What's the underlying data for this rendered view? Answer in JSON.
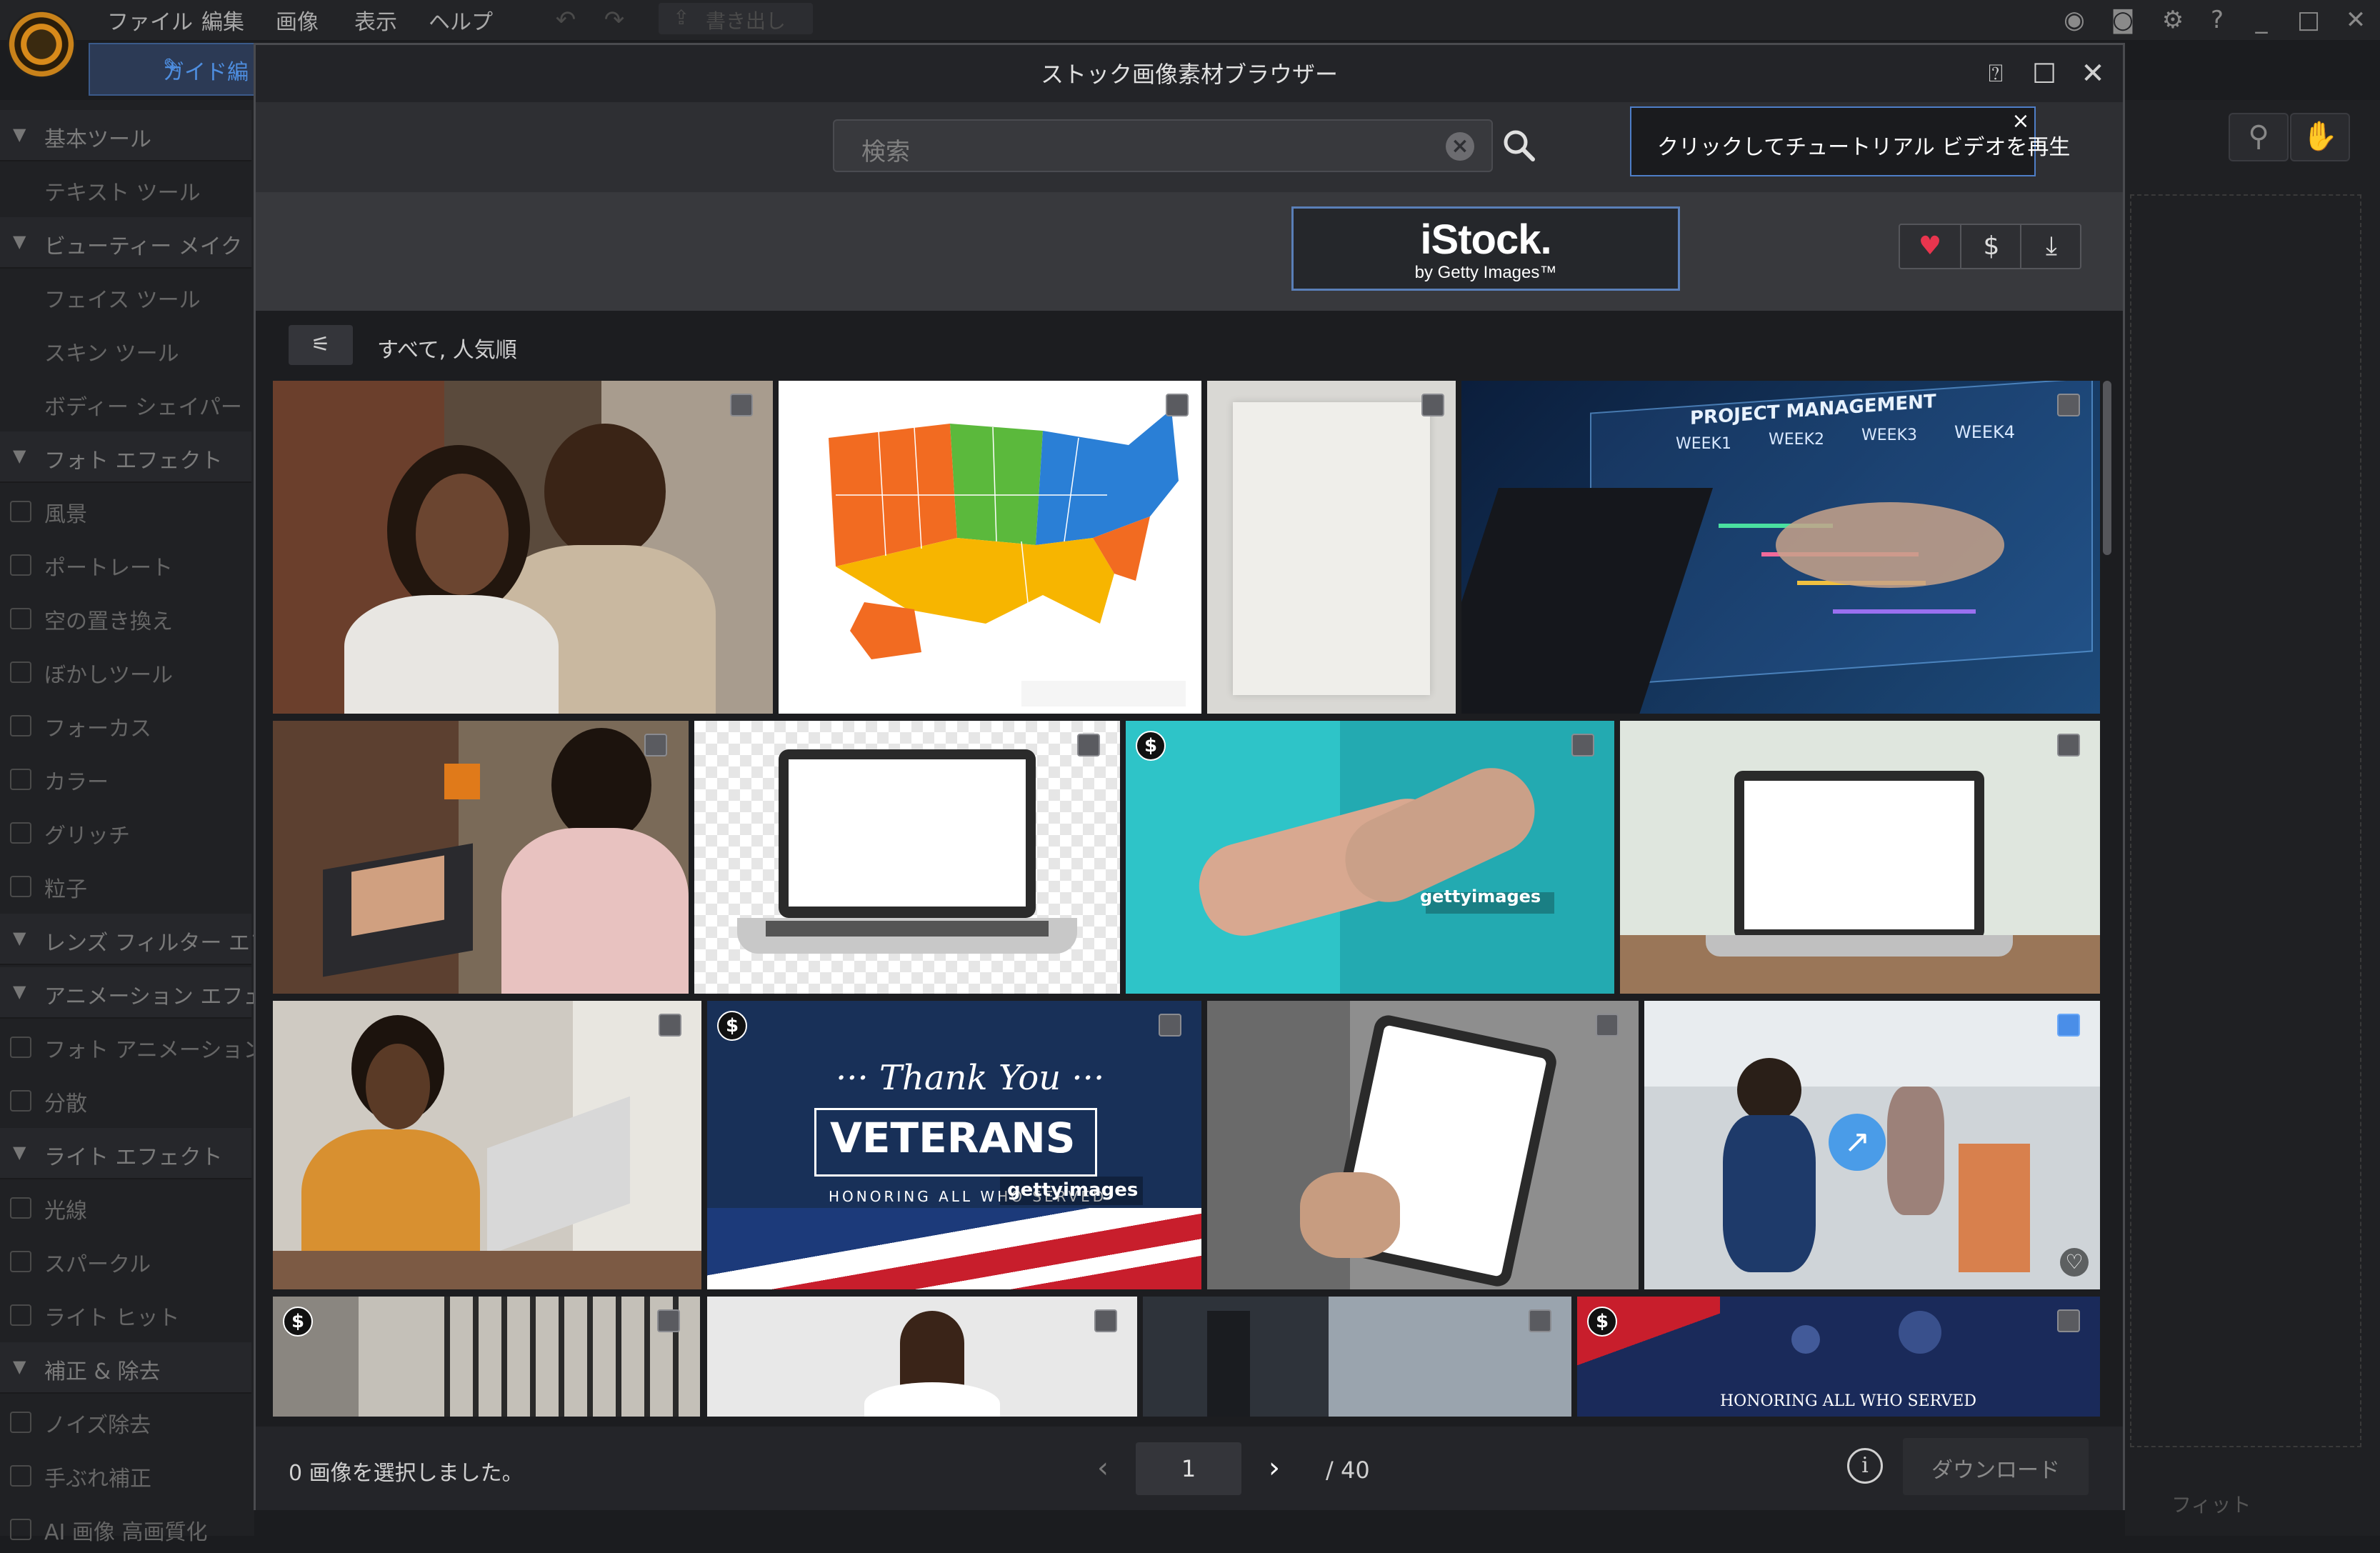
{
  "app": {
    "menu": [
      "ファイル",
      "編集",
      "画像",
      "表示",
      "ヘルプ"
    ],
    "export_label": "書き出し",
    "guide_tab_label": "ガイド編",
    "fit_label": "フィット"
  },
  "sidebar": {
    "items": [
      {
        "type": "head",
        "label": "基本ツール"
      },
      {
        "type": "item",
        "label": "テキスト ツール"
      },
      {
        "type": "head",
        "label": "ビューティー メイク"
      },
      {
        "type": "item",
        "label": "フェイス ツール"
      },
      {
        "type": "item",
        "label": "スキン ツール"
      },
      {
        "type": "item",
        "label": "ボディー シェイパー"
      },
      {
        "type": "head",
        "label": "フォト エフェクト"
      },
      {
        "type": "item",
        "label": "風景"
      },
      {
        "type": "item",
        "label": "ポートレート"
      },
      {
        "type": "item",
        "label": "空の置き換え"
      },
      {
        "type": "item",
        "label": "ぼかしツール"
      },
      {
        "type": "item",
        "label": "フォーカス"
      },
      {
        "type": "item",
        "label": "カラー"
      },
      {
        "type": "item",
        "label": "グリッチ"
      },
      {
        "type": "item",
        "label": "粒子"
      },
      {
        "type": "head",
        "label": "レンズ フィルター エフェクト"
      },
      {
        "type": "head",
        "label": "アニメーション エフェクト"
      },
      {
        "type": "item",
        "label": "フォト アニメーション"
      },
      {
        "type": "item",
        "label": "分散"
      },
      {
        "type": "head",
        "label": "ライト エフェクト"
      },
      {
        "type": "item",
        "label": "光線"
      },
      {
        "type": "item",
        "label": "スパークル"
      },
      {
        "type": "item",
        "label": "ライト ヒット"
      },
      {
        "type": "head",
        "label": "補正 & 除去"
      },
      {
        "type": "item",
        "label": "ノイズ除去"
      },
      {
        "type": "item",
        "label": "手ぶれ補正"
      },
      {
        "type": "item",
        "label": "AI 画像 高画質化"
      }
    ]
  },
  "dialog": {
    "title": "ストック画像素材ブラウザー",
    "search_placeholder": "検索",
    "tooltip": "クリックしてチュートリアル ビデオを再生",
    "provider_name": "iStock.",
    "provider_sub": "by Getty Images™",
    "filter_text": "すべて, 人気順",
    "selected_text": "0 画像を選択しました。",
    "page_current": "1",
    "page_total": "/ 40",
    "download_label": "ダウンロード",
    "colors": {
      "accent": "#4a8ee8",
      "favorite": "#e8354e"
    }
  },
  "tiles": {
    "t4": {
      "title": "PROJECT MANAGEMENT",
      "weeks": [
        "WEEK1",
        "WEEK2",
        "WEEK3",
        "WEEK4"
      ]
    },
    "t7": {
      "watermark": "gettyimages"
    },
    "t10": {
      "top": "··· Thank You ···",
      "main": "VETERANS",
      "sub": "HONORING ALL WHO SERVED",
      "watermark": "gettyimages"
    },
    "t16": {
      "caption": "HONORING ALL WHO SERVED"
    }
  }
}
